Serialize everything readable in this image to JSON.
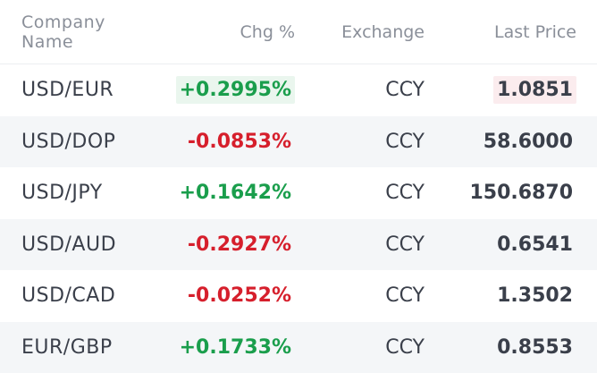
{
  "header": {
    "name": "Company\nName",
    "chg": "Chg %",
    "exchange": "Exchange",
    "price": "Last Price"
  },
  "rows": [
    {
      "name": "USD/EUR",
      "chg": "+0.2995%",
      "exchange": "CCY",
      "price": "1.0851"
    },
    {
      "name": "USD/DOP",
      "chg": "-0.0853%",
      "exchange": "CCY",
      "price": "58.6000"
    },
    {
      "name": "USD/JPY",
      "chg": "+0.1642%",
      "exchange": "CCY",
      "price": "150.6870"
    },
    {
      "name": "USD/AUD",
      "chg": "-0.2927%",
      "exchange": "CCY",
      "price": "0.6541"
    },
    {
      "name": "USD/CAD",
      "chg": "-0.0252%",
      "exchange": "CCY",
      "price": "1.3502"
    },
    {
      "name": "EUR/GBP",
      "chg": "+0.1733%",
      "exchange": "CCY",
      "price": "0.8553"
    }
  ],
  "colors": {
    "positive": "#1a9e4c",
    "negative": "#d61f2c",
    "header_text": "#8a8f99",
    "row_text": "#3a3f4a",
    "alt_row": "#f4f6f8"
  }
}
